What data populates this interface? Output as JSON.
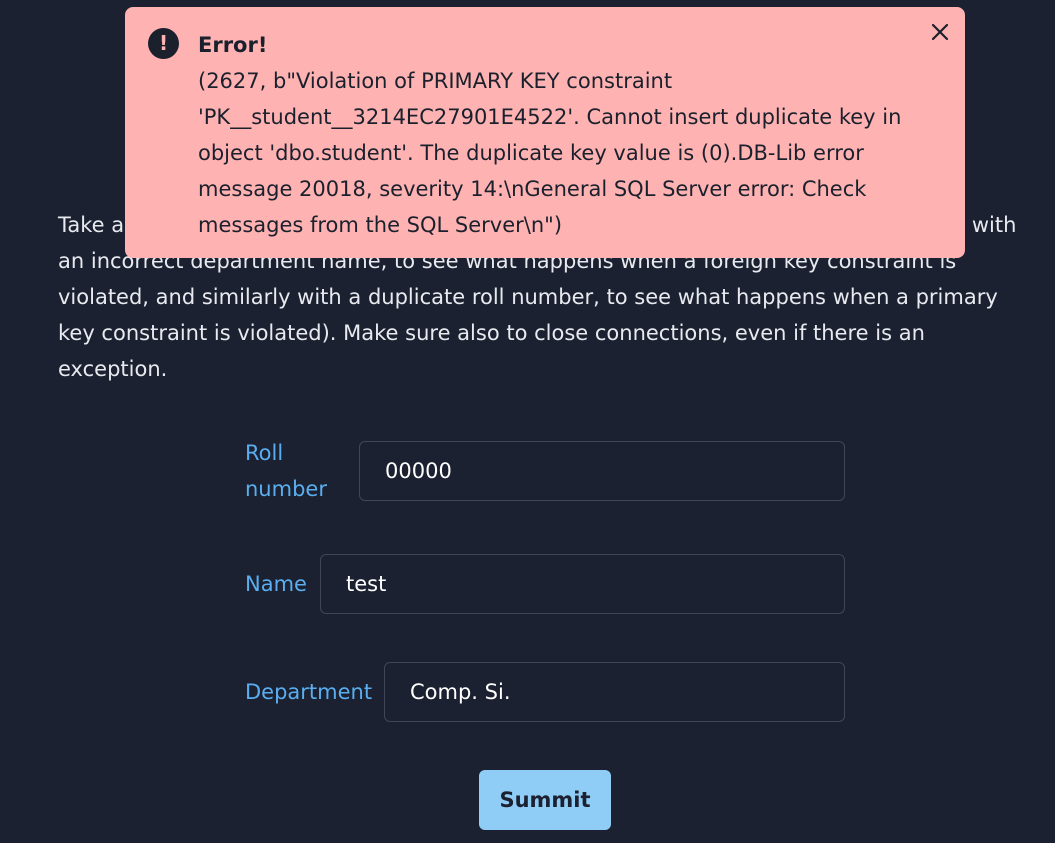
{
  "instructions": {
    "text": "Take a tot_creds set to 0. Make sure you catch exceptions and report them (and test it with an incorrect department name, to see what happens when a foreign key constraint is violated, and similarly with a duplicate roll number, to see what happens when a primary key constraint is violated). Make sure also to close connections, even if there is an exception."
  },
  "form": {
    "roll_label": "Roll number",
    "roll_value": "00000",
    "name_label": "Name",
    "name_value": "test",
    "department_label": "Department",
    "department_value": "Comp. Si.",
    "submit_label": "Summit"
  },
  "alert": {
    "icon": "exclamation-circle-icon",
    "title": "Error!",
    "message": "(2627, b\"Violation of PRIMARY KEY constraint 'PK__student__3214EC27901E4522'. Cannot insert duplicate key in object 'dbo.student'. The duplicate key value is (0).DB-Lib error message 20018, severity 14:\\nGeneral SQL Server error: Check messages from the SQL Server\\n\")",
    "close_icon": "close-icon",
    "background_color": "#feb2b2"
  },
  "colors": {
    "page_background": "#1b2130",
    "label": "#5aaef0",
    "button": "#90cdf6"
  }
}
